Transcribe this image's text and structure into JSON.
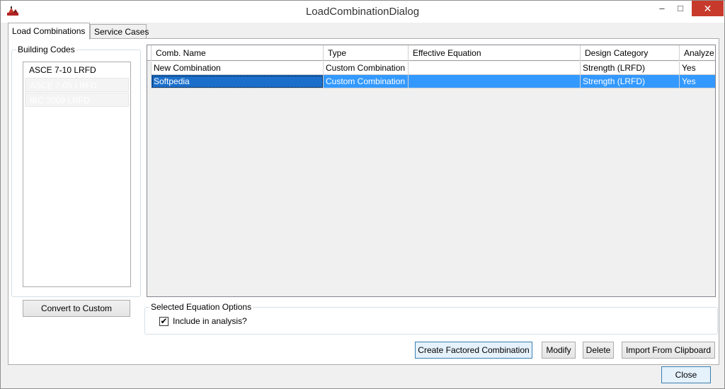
{
  "window": {
    "title": "LoadCombinationDialog"
  },
  "window_controls": {
    "minimize": "–",
    "maximize": "□",
    "close": "✕"
  },
  "tabs": [
    {
      "label": "Load Combinations"
    },
    {
      "label": "Service Cases"
    }
  ],
  "building_codes": {
    "label": "Building Codes",
    "items": [
      {
        "label": "ASCE 7-10 LRFD"
      },
      {
        "label": "ASCE 7-05 LRFD"
      },
      {
        "label": "IBC 2009 LRFD"
      }
    ],
    "convert_button": "Convert to Custom"
  },
  "grid": {
    "columns": [
      "Comb. Name",
      "Type",
      "Effective Equation",
      "Design Category",
      "Analyze"
    ],
    "rows": [
      {
        "name": "New Combination",
        "type": "Custom Combination",
        "equation": "",
        "category": "Strength (LRFD)",
        "analyze": "Yes"
      },
      {
        "name": "Softpedia",
        "type": "Custom Combination",
        "equation": "",
        "category": "Strength (LRFD)",
        "analyze": "Yes"
      }
    ]
  },
  "options": {
    "label": "Selected Equation Options",
    "include_label": "Include in analysis?",
    "include_checked": true,
    "check_mark": "✔"
  },
  "actions": {
    "create": "Create Factored Combination",
    "modify": "Modify",
    "delete": "Delete",
    "import": "Import From Clipboard"
  },
  "footer": {
    "close": "Close"
  },
  "colors": {
    "selection": "#3399ff",
    "close_button": "#c73a2b"
  }
}
